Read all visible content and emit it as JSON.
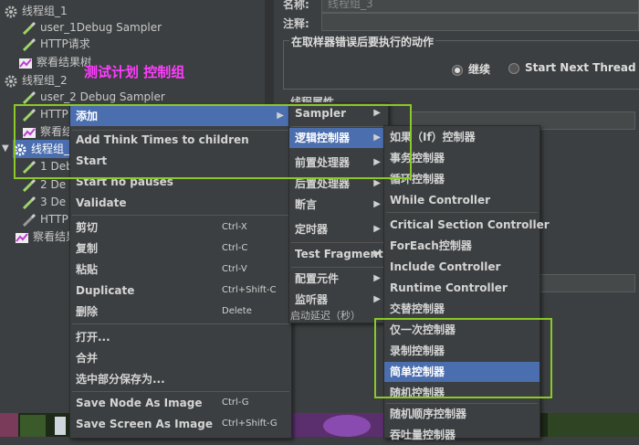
{
  "tree": {
    "items": [
      {
        "label": "线程组_1",
        "icon": "gear-icon"
      },
      {
        "label": "user_1Debug Sampler",
        "icon": "pencil-icon"
      },
      {
        "label": "HTTP请求",
        "icon": "pencil-icon"
      },
      {
        "label": "察看结果树",
        "icon": "chart-icon"
      },
      {
        "label": "线程组_2",
        "icon": "gear-icon"
      },
      {
        "label": "user_2 Debug Sampler",
        "icon": "pencil-icon"
      },
      {
        "label": "HTTP",
        "icon": "pencil-icon"
      },
      {
        "label": "察看结",
        "icon": "chart-icon"
      },
      {
        "label": "线程组_",
        "icon": "gear-icon"
      },
      {
        "label": "1 Deb",
        "icon": "pencil-icon"
      },
      {
        "label": "2 De",
        "icon": "pencil-icon"
      },
      {
        "label": "3 De",
        "icon": "pencil-icon"
      },
      {
        "label": "HTTP",
        "icon": "pencil-icon"
      },
      {
        "label": "察看结果",
        "icon": "chart-icon"
      }
    ]
  },
  "right": {
    "name_label": "名称:",
    "name_value": "线程组_3",
    "comment_label": "注释:",
    "group_title": "在取样器错误后要执行的动作",
    "radio_continue": "继续",
    "radio_next": "Start Next Thread Loo",
    "props_label": "线程属性"
  },
  "annotation": "测试计划 控制组",
  "menu1": {
    "items": [
      {
        "label": "添加",
        "shortcut": "",
        "submenu": true
      },
      {
        "label": "Add Think Times to children",
        "shortcut": ""
      },
      {
        "label": "Start",
        "shortcut": ""
      },
      {
        "label": "Start no pauses",
        "shortcut": ""
      },
      {
        "label": "Validate",
        "shortcut": ""
      },
      {
        "label": "剪切",
        "shortcut": "Ctrl-X"
      },
      {
        "label": "复制",
        "shortcut": "Ctrl-C"
      },
      {
        "label": "粘贴",
        "shortcut": "Ctrl-V"
      },
      {
        "label": "Duplicate",
        "shortcut": "Ctrl+Shift-C"
      },
      {
        "label": "删除",
        "shortcut": "Delete"
      },
      {
        "label": "打开...",
        "shortcut": ""
      },
      {
        "label": "合并",
        "shortcut": ""
      },
      {
        "label": "选中部分保存为...",
        "shortcut": ""
      },
      {
        "label": "Save Node As Image",
        "shortcut": "Ctrl-G"
      },
      {
        "label": "Save Screen As Image",
        "shortcut": "Ctrl+Shift-G"
      }
    ]
  },
  "menu2": {
    "items": [
      {
        "label": "Sampler",
        "submenu": true
      },
      {
        "label": "逻辑控制器",
        "submenu": true
      },
      {
        "label": "前置处理器",
        "submenu": true
      },
      {
        "label": "后置处理器",
        "submenu": true
      },
      {
        "label": "断言",
        "submenu": true
      },
      {
        "label": "定时器",
        "submenu": true
      },
      {
        "label": "Test Fragment",
        "submenu": true
      },
      {
        "label": "配置元件",
        "submenu": true
      },
      {
        "label": "监听器",
        "submenu": true
      }
    ],
    "tail_text": "启动延迟（秒）"
  },
  "menu3": {
    "items": [
      {
        "label": "如果（If）控制器"
      },
      {
        "label": "事务控制器"
      },
      {
        "label": "循环控制器"
      },
      {
        "label": "While Controller"
      },
      {
        "label": "Critical Section Controller"
      },
      {
        "label": "ForEach控制器"
      },
      {
        "label": "Include Controller"
      },
      {
        "label": "Runtime Controller"
      },
      {
        "label": "交替控制器"
      },
      {
        "label": "仅一次控制器"
      },
      {
        "label": "录制控制器"
      },
      {
        "label": "简单控制器"
      },
      {
        "label": "随机控制器"
      },
      {
        "label": "随机顺序控制器"
      },
      {
        "label": "吞吐量控制器"
      }
    ]
  },
  "colors": {
    "highlight": "#4b6eaf",
    "annotation_box": "#8ac926",
    "annotation_text": "#ff3cff"
  }
}
